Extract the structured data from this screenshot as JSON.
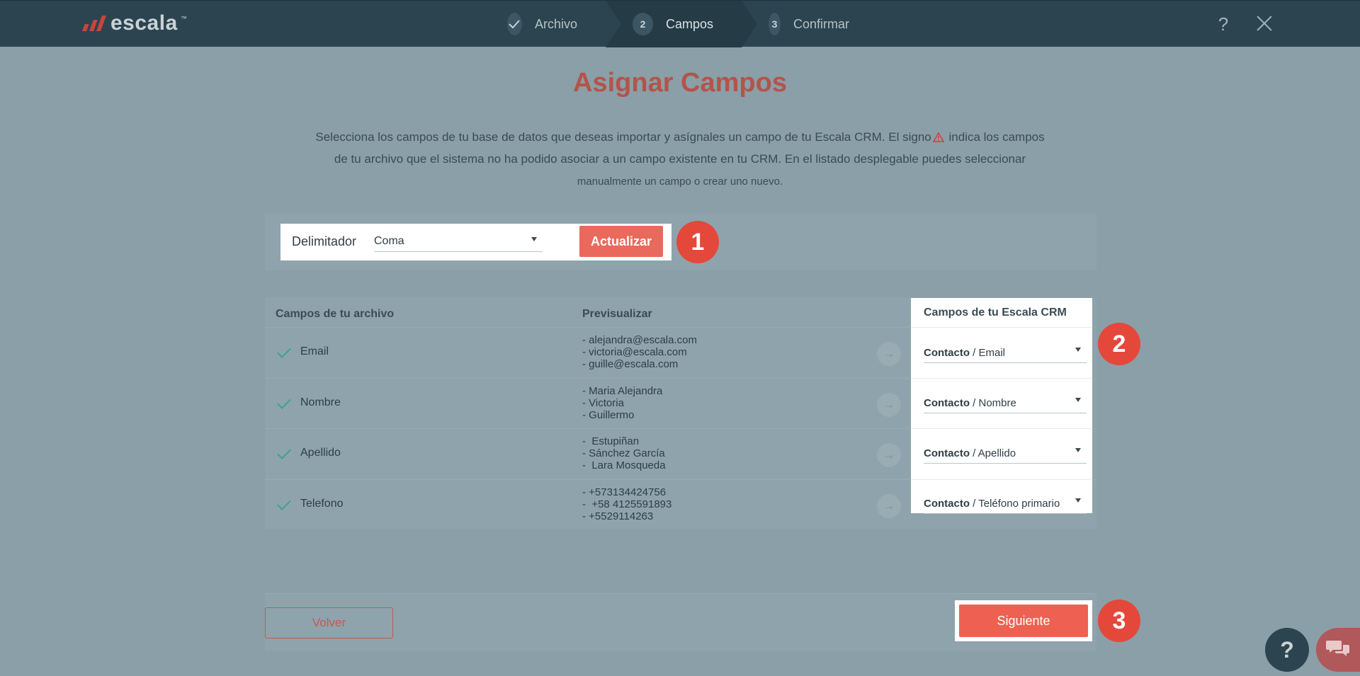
{
  "header": {
    "logo_text": "escala",
    "logo_tm": "™",
    "steps": [
      {
        "number": "",
        "label": "Archivo",
        "state": "done"
      },
      {
        "number": "2",
        "label": "Campos",
        "state": "active"
      },
      {
        "number": "3",
        "label": "Confirmar",
        "state": "pending"
      }
    ],
    "help_label": "?"
  },
  "page": {
    "title": "Asignar Campos",
    "description_part1": "Selecciona los campos de tu base de datos que deseas importar y asígnales un campo de tu Escala CRM. El signo",
    "description_part2": "indica los campos de tu archivo que el sistema no ha podido asociar a un campo existente en tu CRM. En el listado desplegable puedes seleccionar",
    "description_part3": "manualmente un campo o crear uno nuevo."
  },
  "delimiter": {
    "label": "Delimitador",
    "value": "Coma",
    "update_button": "Actualizar"
  },
  "badges": [
    "1",
    "2",
    "3"
  ],
  "table": {
    "headers": {
      "file_fields": "Campos de tu archivo",
      "preview": "Previsualizar",
      "crm_fields": "Campos de tu Escala CRM"
    },
    "rows": [
      {
        "field": "Email",
        "preview": [
          "- alejandra@escala.com",
          "- victoria@escala.com",
          "- guille@escala.com"
        ],
        "crm_entity": "Contacto",
        "crm_field": " / Email"
      },
      {
        "field": "Nombre",
        "preview": [
          "- Maria Alejandra",
          "- Victoria",
          "- Guillermo"
        ],
        "crm_entity": "Contacto",
        "crm_field": " / Nombre"
      },
      {
        "field": "Apellido",
        "preview": [
          "-  Estupiñan",
          "- Sánchez García",
          "-  Lara Mosqueda"
        ],
        "crm_entity": "Contacto",
        "crm_field": " / Apellido"
      },
      {
        "field": "Telefono",
        "preview": [
          "- +573134424756",
          "-  +58 4125591893",
          "- +5529114263"
        ],
        "crm_entity": "Contacto",
        "crm_field": " / Teléfono primario"
      }
    ]
  },
  "footer": {
    "back_button": "Volver",
    "next_button": "Siguiente"
  },
  "fab": {
    "help_label": "?"
  },
  "colors": {
    "accent": "#e96a5c",
    "badge": "#e4483a",
    "header": "#2b4450",
    "title": "#b3544a",
    "check": "#3aa586"
  }
}
